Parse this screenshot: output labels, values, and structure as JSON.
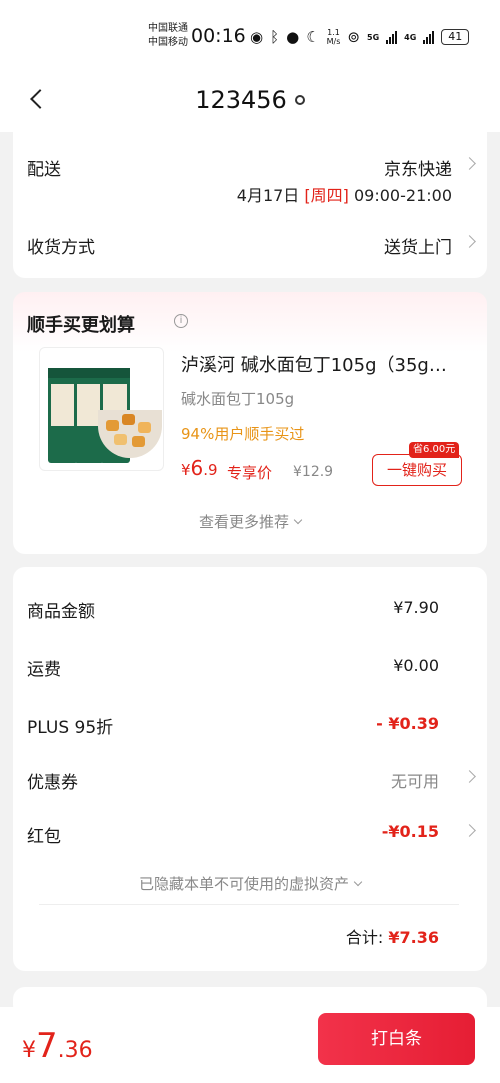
{
  "status_bar": {
    "carrier_1": "中国联通",
    "carrier_2": "中国移动",
    "time": "00:16",
    "speed_top": "1.1",
    "speed_bottom": "M/s",
    "net_1": "5G",
    "net_2": "4G",
    "battery": "41"
  },
  "header": {
    "title": "123456"
  },
  "delivery": {
    "label": "配送",
    "carrier": "京东快递",
    "date": "4月17日",
    "weekday": "[周四]",
    "hours": "09:00-21:00",
    "method_label": "收货方式",
    "method_value": "送货上门"
  },
  "recommend": {
    "title": "顺手买更划算",
    "product": {
      "name": "泸溪河 碱水面包丁105g（35g…",
      "spec": "碱水面包丁105g",
      "stat": "94%用户顺手买过",
      "price_symbol": "¥",
      "price_int": "6",
      "price_dec": ".9",
      "price_tag": "专享价",
      "original_price": "¥12.9",
      "save_badge": "省6.00元",
      "buy_label": "一键购买"
    },
    "more_label": "查看更多推荐"
  },
  "summary": {
    "items": [
      {
        "label": "商品金额",
        "value": "¥7.90"
      },
      {
        "label": "运费",
        "value": "¥0.00"
      },
      {
        "label": "PLUS 95折",
        "value": "- ¥0.39"
      },
      {
        "label": "优惠券",
        "value": "无可用"
      },
      {
        "label": "红包",
        "value": "-¥0.15"
      }
    ],
    "hidden_note": "已隐藏本单不可使用的虚拟资产",
    "total_label": "合计:",
    "total_value": "¥7.36"
  },
  "bottom": {
    "symbol": "¥",
    "int": "7",
    "dec": ".36",
    "pay_label": "打白条"
  },
  "colors": {
    "accent": "#e2231a",
    "orange": "#e89417",
    "muted": "#888888"
  }
}
